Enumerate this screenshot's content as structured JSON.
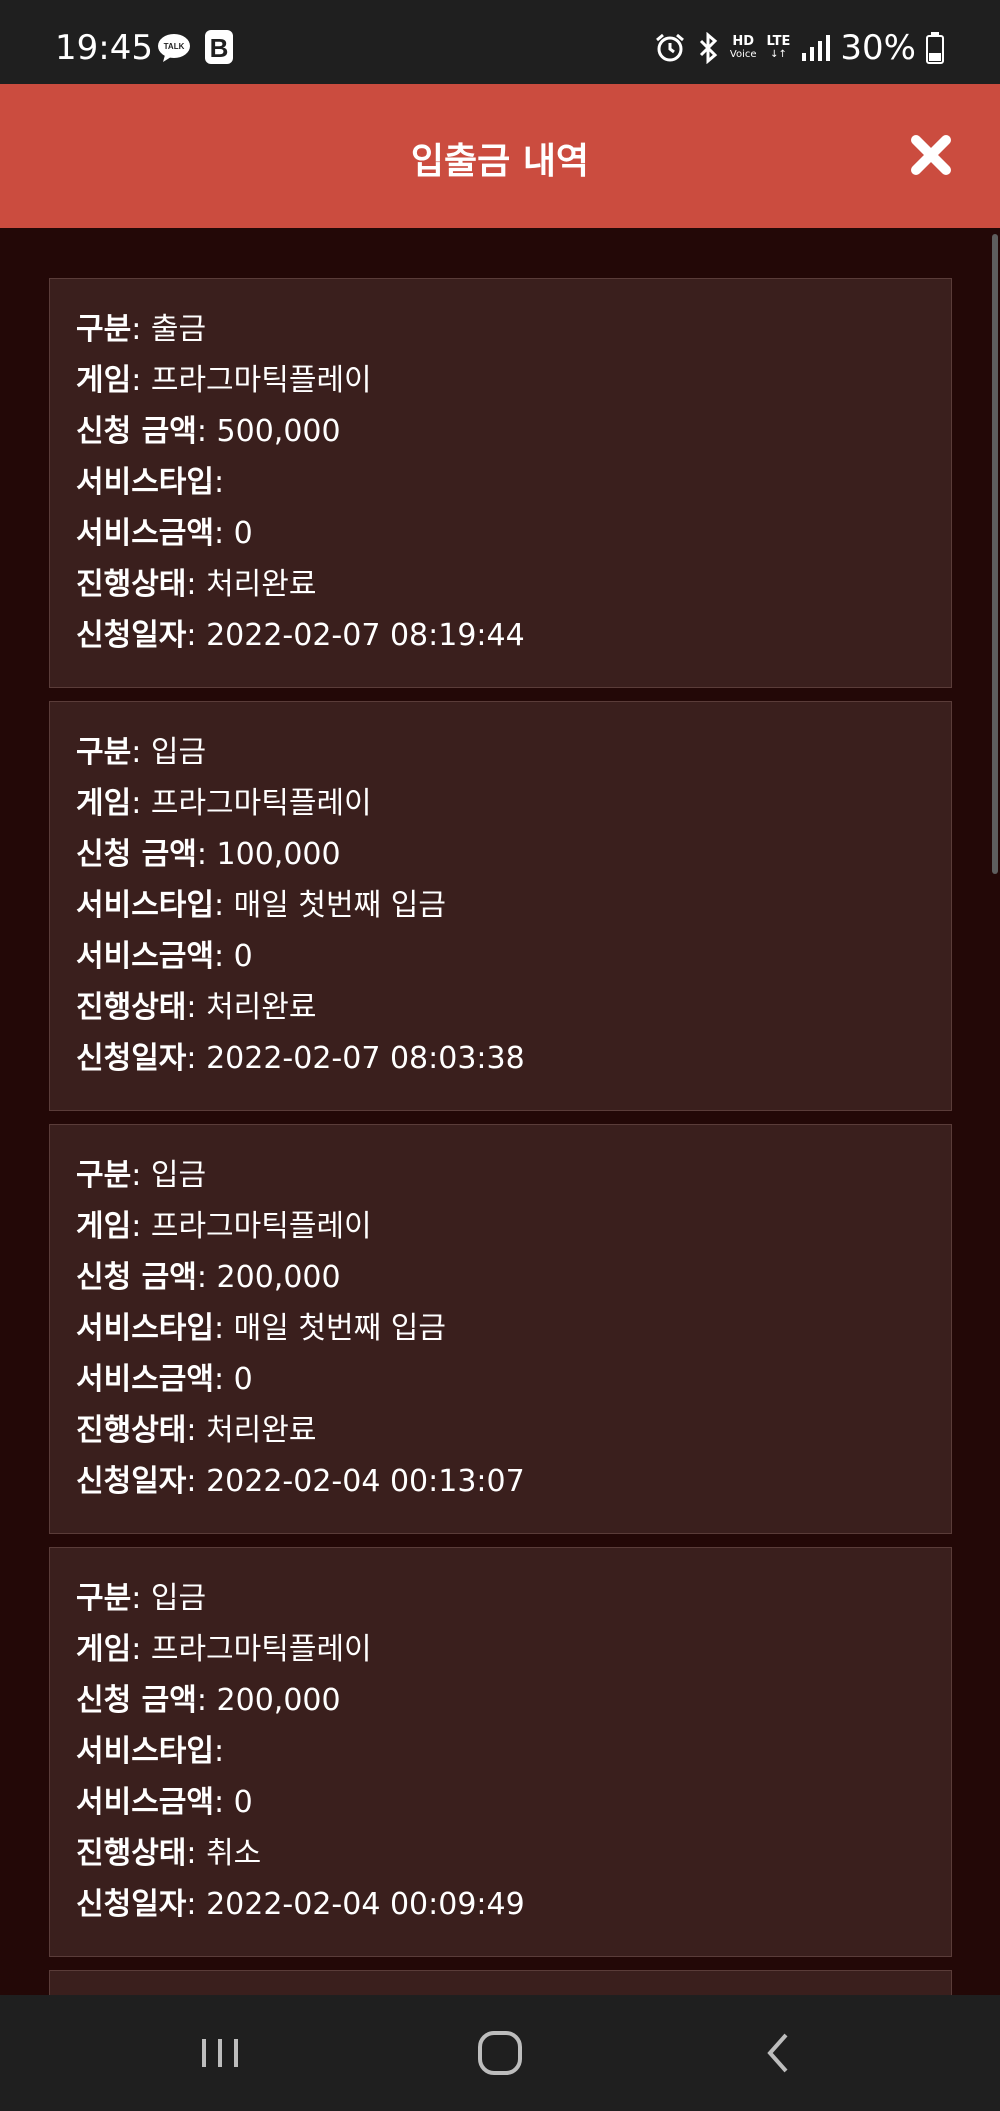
{
  "status_bar": {
    "time": "19:45",
    "talk_badge": "TALK",
    "b_icon": "B",
    "hd_top": "HD",
    "hd_bottom": "Voice",
    "lte": "LTE",
    "battery": "30%",
    "icons": [
      "alarm-icon",
      "bluetooth-icon",
      "signal-icon",
      "battery-icon"
    ]
  },
  "header": {
    "title": "입출금 내역",
    "close_icon": "close-icon",
    "bg_color": "#cb4c3f"
  },
  "field_labels": {
    "type": "구분",
    "game": "게임",
    "amount": "신청 금액",
    "service_type": "서비스타입",
    "service_amount": "서비스금액",
    "status": "진행상태",
    "date": "신청일자"
  },
  "records": [
    {
      "type": "출금",
      "game": "프라그마틱플레이",
      "amount": "500,000",
      "service_type": "",
      "service_amount": "0",
      "status": "처리완료",
      "date": "2022-02-07 08:19:44"
    },
    {
      "type": "입금",
      "game": "프라그마틱플레이",
      "amount": "100,000",
      "service_type": "매일 첫번째 입금",
      "service_amount": "0",
      "status": "처리완료",
      "date": "2022-02-07 08:03:38"
    },
    {
      "type": "입금",
      "game": "프라그마틱플레이",
      "amount": "200,000",
      "service_type": "매일 첫번째 입금",
      "service_amount": "0",
      "status": "처리완료",
      "date": "2022-02-04 00:13:07"
    },
    {
      "type": "입금",
      "game": "프라그마틱플레이",
      "amount": "200,000",
      "service_type": "",
      "service_amount": "0",
      "status": "취소",
      "date": "2022-02-04 00:09:49"
    }
  ],
  "nav_bar": {
    "buttons": [
      "recent-apps-icon",
      "home-icon",
      "back-icon"
    ]
  }
}
